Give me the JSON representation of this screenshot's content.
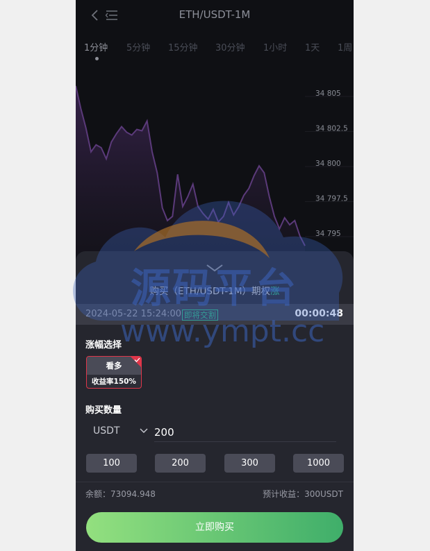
{
  "header": {
    "title": "ETH/USDT-1M"
  },
  "tabs": [
    {
      "label": "1分钟"
    },
    {
      "label": "5分钟"
    },
    {
      "label": "15分钟"
    },
    {
      "label": "30分钟"
    },
    {
      "label": "1小时"
    },
    {
      "label": "1天"
    },
    {
      "label": "1周"
    }
  ],
  "chart_data": {
    "type": "line",
    "y_ticks": [
      "34 805",
      "34 802.5",
      "34 800",
      "34 797.5",
      "34 795"
    ],
    "y": [
      34805.5,
      34803.9,
      34802.5,
      34800.8,
      34801.3,
      34801.1,
      34800.3,
      34801.5,
      34802.1,
      34802.6,
      34802.2,
      34802.0,
      34802.4,
      34802.3,
      34803.0,
      34800.8,
      34799.3,
      34796.8,
      34795.9,
      34796.2,
      34799.2,
      34796.9,
      34797.6,
      34798.5,
      34796.9,
      34796.4,
      34796.0,
      34796.7,
      34795.8,
      34796.2,
      34797.2,
      34796.3,
      34796.9,
      34797.7,
      34798.2,
      34799.1,
      34799.8,
      34799.3,
      34797.6,
      34796.2,
      34795.3,
      34796.1,
      34795.6,
      34795.9,
      34794.8,
      34794.1
    ],
    "line_color": "#5b3a7a"
  },
  "panel": {
    "buy_title": "购买（ETH/USDT-1M）期权",
    "direction": "涨",
    "datetime": "2024-05-22 15:24:00",
    "badge": "即将交割",
    "countdown": "00:00:48",
    "range_label": "涨幅选择",
    "option": {
      "label": "看多",
      "rate": "收益率150%"
    },
    "qty_label": "购买数量",
    "currency": "USDT",
    "amount": "200",
    "presets": [
      "100",
      "200",
      "300",
      "1000"
    ],
    "balance": "余额：73094.948",
    "profit": "预计收益：300USDT",
    "buy_button": "立即购买"
  },
  "watermark": {
    "text": "源码平台",
    "url": "www.ympt.cc"
  }
}
